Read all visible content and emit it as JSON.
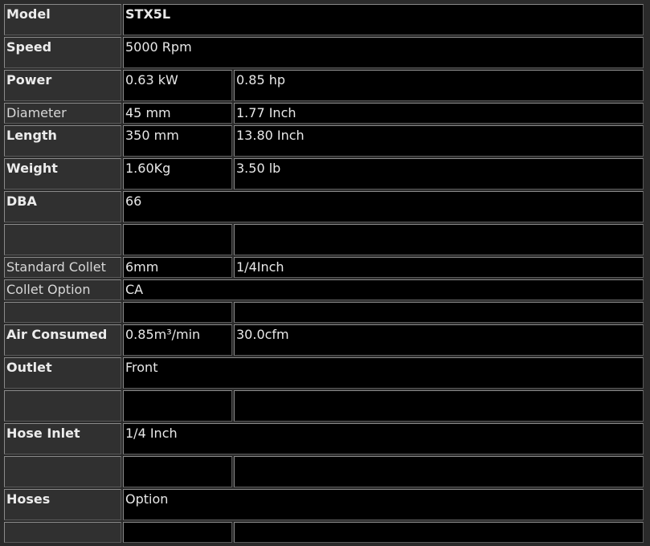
{
  "rows": [
    {
      "label": "Model",
      "bold": true,
      "cells": [
        "STX5L"
      ],
      "value_bold": true
    },
    {
      "label": "Speed",
      "bold": true,
      "cells": [
        "5000 Rpm"
      ]
    },
    {
      "label": "Power",
      "bold": true,
      "cells": [
        "0.63 kW",
        "0.85 hp"
      ]
    },
    {
      "label": "Diameter",
      "bold": false,
      "cells": [
        "45 mm",
        "1.77 Inch"
      ]
    },
    {
      "label": "Length",
      "bold": true,
      "cells": [
        "350 mm",
        "13.80 Inch"
      ]
    },
    {
      "label": "Weight",
      "bold": true,
      "cells": [
        "1.60Kg",
        "3.50 lb"
      ]
    },
    {
      "label": "DBA",
      "bold": true,
      "cells": [
        "66"
      ]
    },
    {
      "label": "",
      "bold": true,
      "cells": [
        "",
        ""
      ],
      "empty": true
    },
    {
      "label": "Standard Collet",
      "bold": false,
      "cells": [
        "6mm",
        "1/4Inch"
      ]
    },
    {
      "label": "Collet Option",
      "bold": false,
      "cells": [
        "CA"
      ]
    },
    {
      "label": "",
      "bold": true,
      "cells": [
        "",
        ""
      ],
      "empty": true
    },
    {
      "label": "Air Consumed",
      "bold": true,
      "cells": [
        "0.85m³/min",
        "30.0cfm"
      ]
    },
    {
      "label": "Outlet",
      "bold": true,
      "cells": [
        "Front"
      ]
    },
    {
      "label": "",
      "bold": true,
      "cells": [
        "",
        ""
      ],
      "empty": true
    },
    {
      "label": "Hose Inlet",
      "bold": true,
      "cells": [
        "1/4 Inch"
      ]
    },
    {
      "label": "",
      "bold": true,
      "cells": [
        "",
        ""
      ],
      "empty": true
    },
    {
      "label": "Hoses",
      "bold": true,
      "cells": [
        "Option"
      ]
    },
    {
      "label": "",
      "bold": true,
      "cells": [
        "",
        ""
      ],
      "empty": true
    }
  ]
}
